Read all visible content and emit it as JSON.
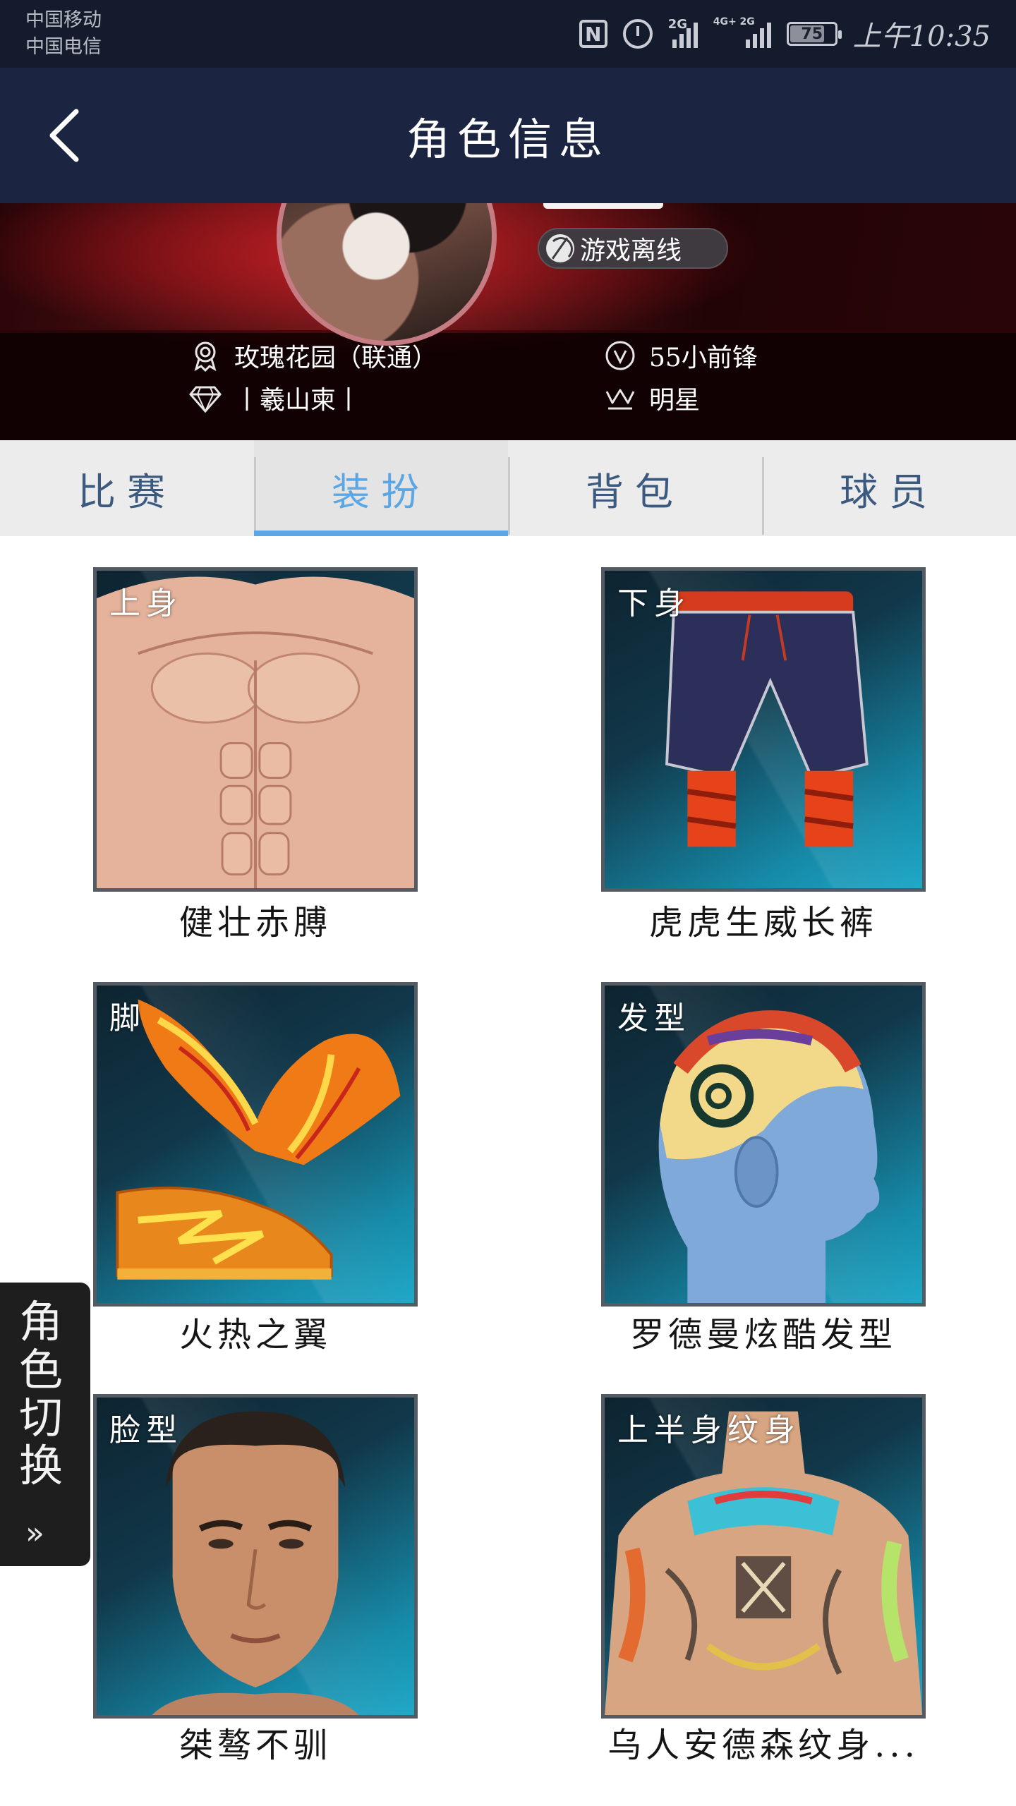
{
  "status_bar": {
    "carrier1": "中国移动",
    "carrier2": "中国电信",
    "nfc": "N",
    "sig1_label": "2G",
    "sig2_label": "4G+ 2G",
    "battery": "75",
    "time": "上午10:35"
  },
  "nav": {
    "title": "角色信息",
    "back_icon": "chevron-left-icon"
  },
  "profile": {
    "status": "游戏离线",
    "team": "玫瑰花园（联通）",
    "position": "55小前锋",
    "club": "丨羲山柬丨",
    "rank": "明星"
  },
  "tabs": [
    {
      "label": "比赛",
      "active": false
    },
    {
      "label": "装扮",
      "active": true
    },
    {
      "label": "背包",
      "active": false
    },
    {
      "label": "球员",
      "active": false
    }
  ],
  "items": [
    {
      "tag": "上身",
      "name": "健壮赤膊"
    },
    {
      "tag": "下身",
      "name": "虎虎生威长裤"
    },
    {
      "tag": "脚",
      "name": "火热之翼"
    },
    {
      "tag": "发型",
      "name": "罗德曼炫酷发型"
    },
    {
      "tag": "脸型",
      "name": "桀骜不驯"
    },
    {
      "tag": "上半身纹身",
      "name": "乌人安德森纹身..."
    }
  ],
  "side_tab": {
    "label": "角色切换",
    "arrow": "»"
  },
  "colors": {
    "nav_bg": "#1b2541",
    "status_bg": "#141b2c",
    "tab_active": "#5ba7e5",
    "tab_text": "#3c5a80"
  }
}
